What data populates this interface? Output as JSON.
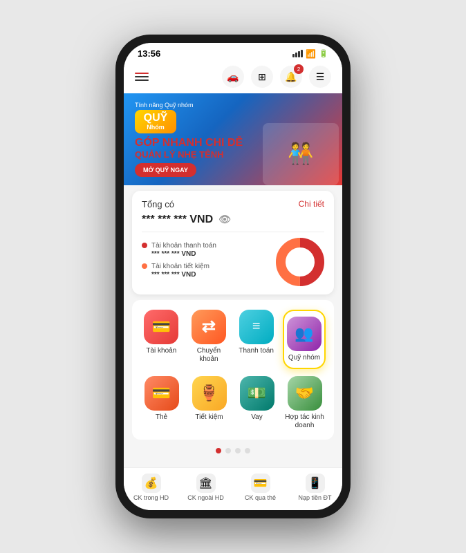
{
  "status": {
    "time": "13:56",
    "signal": "●●●",
    "wifi": "WiFi",
    "battery": "Battery"
  },
  "nav": {
    "icons": [
      "🚗",
      "⊞",
      "🔔",
      "☰"
    ],
    "notification_badge": "2"
  },
  "banner": {
    "subtitle": "Tính năng Quỹ nhóm",
    "quy": "QUỸ",
    "nhom": "Nhóm",
    "headline1": "GÓP NHANH CHI DỄ",
    "headline2": "QUẢN LÝ NHẸ TÊNH",
    "cta": "MỞ QUỸ NGAY"
  },
  "balance": {
    "title": "Tổng có",
    "detail": "Chi tiết",
    "amount": "*** *** *** VND",
    "accounts": [
      {
        "label": "Tài khoản thanh toán",
        "amount": "*** *** *** VND",
        "color": "red"
      },
      {
        "label": "Tài khoản tiết kiệm",
        "amount": "*** *** *** VND",
        "color": "orange"
      }
    ]
  },
  "services": {
    "rows": [
      [
        {
          "id": "tai-khoan",
          "label": "Tài khoản",
          "icon": "💳",
          "bg": "icon-red"
        },
        {
          "id": "chuyen-khoan",
          "label": "Chuyển khoản",
          "icon": "⇄",
          "bg": "icon-orange"
        },
        {
          "id": "thanh-toan",
          "label": "Thanh toán",
          "icon": "☰",
          "bg": "icon-teal"
        },
        {
          "id": "quy-nhom",
          "label": "Quỹ nhóm",
          "icon": "👥",
          "bg": "icon-purple",
          "highlighted": true
        }
      ],
      [
        {
          "id": "the",
          "label": "Thẻ",
          "icon": "💳",
          "bg": "icon-card"
        },
        {
          "id": "tiet-kiem",
          "label": "Tiết kiệm",
          "icon": "🏺",
          "bg": "icon-savings"
        },
        {
          "id": "vay",
          "label": "Vay",
          "icon": "💵",
          "bg": "icon-loan"
        },
        {
          "id": "hop-tac",
          "label": "Hợp tác kinh doanh",
          "icon": "🤝",
          "bg": "icon-biz"
        }
      ]
    ]
  },
  "page_dots": [
    true,
    false,
    false,
    false
  ],
  "bottom_nav": [
    {
      "id": "ck-trong-hd",
      "icon": "💰",
      "label": "CK trong HD"
    },
    {
      "id": "ck-ngoai-hd",
      "icon": "🏛",
      "label": "CK ngoài HD"
    },
    {
      "id": "ck-qua-the",
      "icon": "💳",
      "label": "CK qua thẻ"
    },
    {
      "id": "nap-tien-dt",
      "icon": "📱",
      "label": "Nạp tiền ĐT"
    }
  ]
}
